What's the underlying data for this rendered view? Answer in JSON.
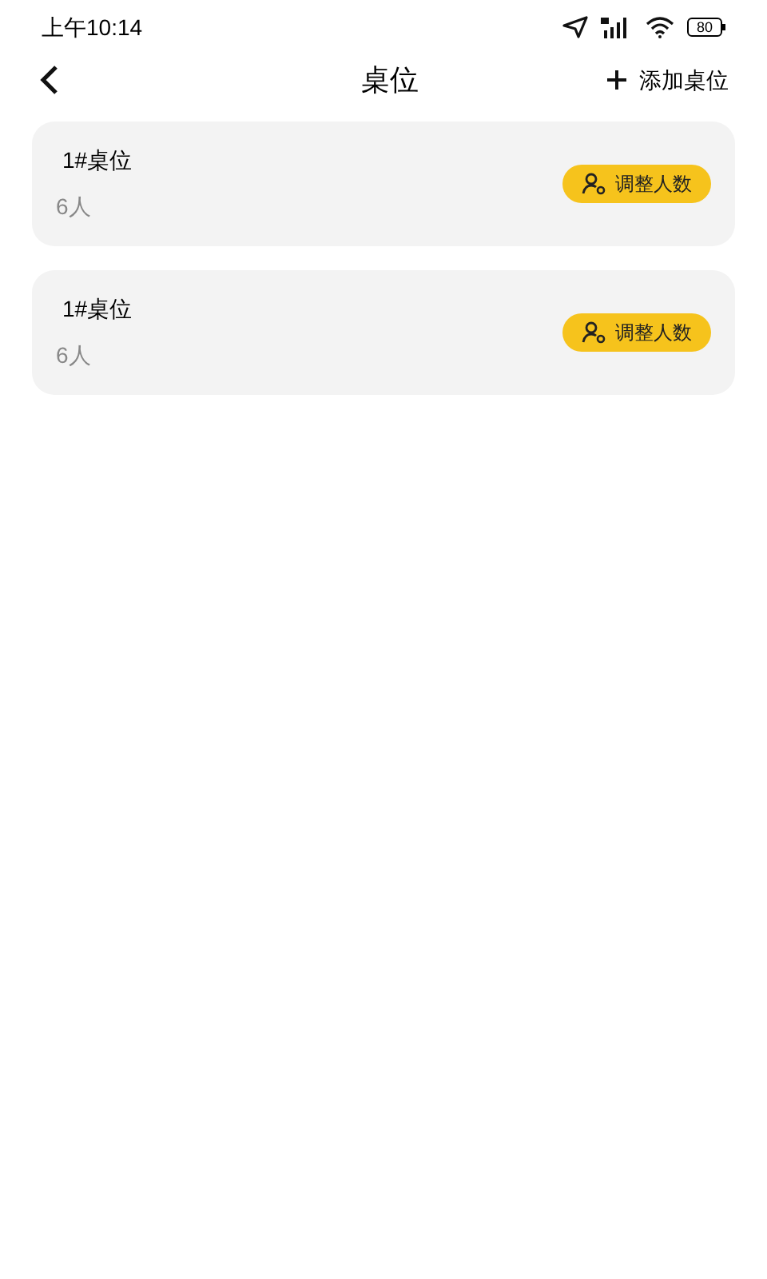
{
  "status_bar": {
    "time": "上午10:14",
    "battery": "80"
  },
  "header": {
    "title": "桌位",
    "action": "添加桌位"
  },
  "tables": [
    {
      "name": "1#桌位",
      "seats": "6人",
      "button": "调整人数"
    },
    {
      "name": "1#桌位",
      "seats": "6人",
      "button": "调整人数"
    }
  ]
}
